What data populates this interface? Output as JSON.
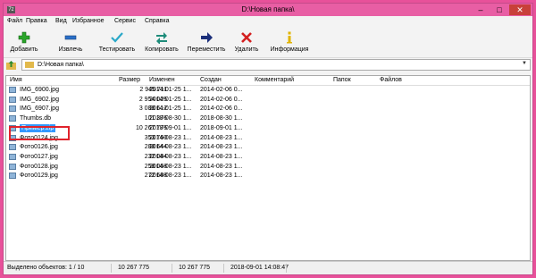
{
  "window": {
    "title": "D:\\Новая папка\\",
    "app_icon": "7z"
  },
  "menu": [
    "Файл",
    "Правка",
    "Вид",
    "Избранное",
    "Сервис",
    "Справка"
  ],
  "toolbar": [
    {
      "label": "Добавить",
      "icon": "plus-icon"
    },
    {
      "label": "Извлечь",
      "icon": "minus-icon"
    },
    {
      "label": "Тестировать",
      "icon": "check-icon"
    },
    {
      "label": "Копировать",
      "icon": "copy-arrows-icon"
    },
    {
      "label": "Переместить",
      "icon": "move-arrow-icon"
    },
    {
      "label": "Удалить",
      "icon": "delete-x-icon"
    },
    {
      "label": "Информация",
      "icon": "info-icon"
    }
  ],
  "address": "D:\\Новая папка\\",
  "columns": [
    "Имя",
    "Размер",
    "Изменен",
    "Создан",
    "Комментарий",
    "Папок",
    "Файлов"
  ],
  "files": [
    {
      "name": "IMG_6900.jpg",
      "size": "2 945 711",
      "modified": "2014-01-25 1...",
      "created": "2014-02-06 0..."
    },
    {
      "name": "IMG_6902.jpg",
      "size": "2 954 025",
      "modified": "2014-01-25 1...",
      "created": "2014-02-06 0..."
    },
    {
      "name": "IMG_6907.jpg",
      "size": "3 088 612",
      "modified": "2014-01-25 1...",
      "created": "2014-02-06 0..."
    },
    {
      "name": "Thumbs.db",
      "size": "101 376",
      "modified": "2018-08-30 1...",
      "created": "2018-08-30 1..."
    },
    {
      "name": "Пример.zip",
      "size": "10 267 775",
      "modified": "2018-09-01 1...",
      "created": "2018-09-01 1..."
    },
    {
      "name": "Фото0124.jpg",
      "size": "353 760",
      "modified": "2014-08-23 1...",
      "created": "2014-08-23 1..."
    },
    {
      "name": "Фото0126.jpg",
      "size": "288 644",
      "modified": "2014-08-23 1...",
      "created": "2014-08-23 1..."
    },
    {
      "name": "Фото0127.jpg",
      "size": "232 084",
      "modified": "2014-08-23 1...",
      "created": "2014-08-23 1..."
    },
    {
      "name": "Фото0128.jpg",
      "size": "258 068",
      "modified": "2014-08-23 1...",
      "created": "2014-08-23 1..."
    },
    {
      "name": "Фото0129.jpg",
      "size": "272 688",
      "modified": "2014-08-23 1...",
      "created": "2014-08-23 1..."
    }
  ],
  "selected_index": 4,
  "status": {
    "selection": "Выделено объектов: 1 / 10",
    "size1": "10 267 775",
    "size2": "10 267 775",
    "datetime": "2018-09-01 14:08:47"
  },
  "colors": {
    "title_bg": "#e85ea4",
    "selection": "#3399ff",
    "highlight_border": "#e0232c"
  }
}
